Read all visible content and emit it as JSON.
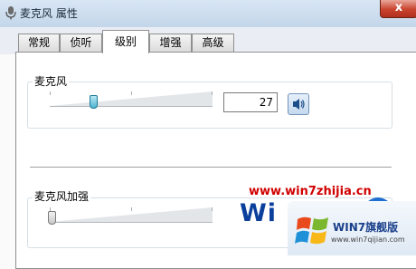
{
  "window": {
    "title": "麦克风 属性",
    "close_symbol": "x"
  },
  "tabs": [
    {
      "label": "常规",
      "active": false
    },
    {
      "label": "侦听",
      "active": false
    },
    {
      "label": "级别",
      "active": true
    },
    {
      "label": "增强",
      "active": false
    },
    {
      "label": "高级",
      "active": false
    }
  ],
  "microphone": {
    "label": "麦克风",
    "value": "27",
    "level": 0.27,
    "speaker_icon": "speaker-icon"
  },
  "boost": {
    "label": "麦克风加强",
    "level": 0.0
  },
  "watermark": {
    "url": "www.win7zhijia.cn",
    "text": "Wi"
  },
  "badge": {
    "brand": "WIN7旗舰版",
    "url": "www.win7qijian.com"
  },
  "colors": {
    "accent": "#1d7a96",
    "watermark_red": "#d10000",
    "watermark_blue": "#0a3f9c"
  }
}
